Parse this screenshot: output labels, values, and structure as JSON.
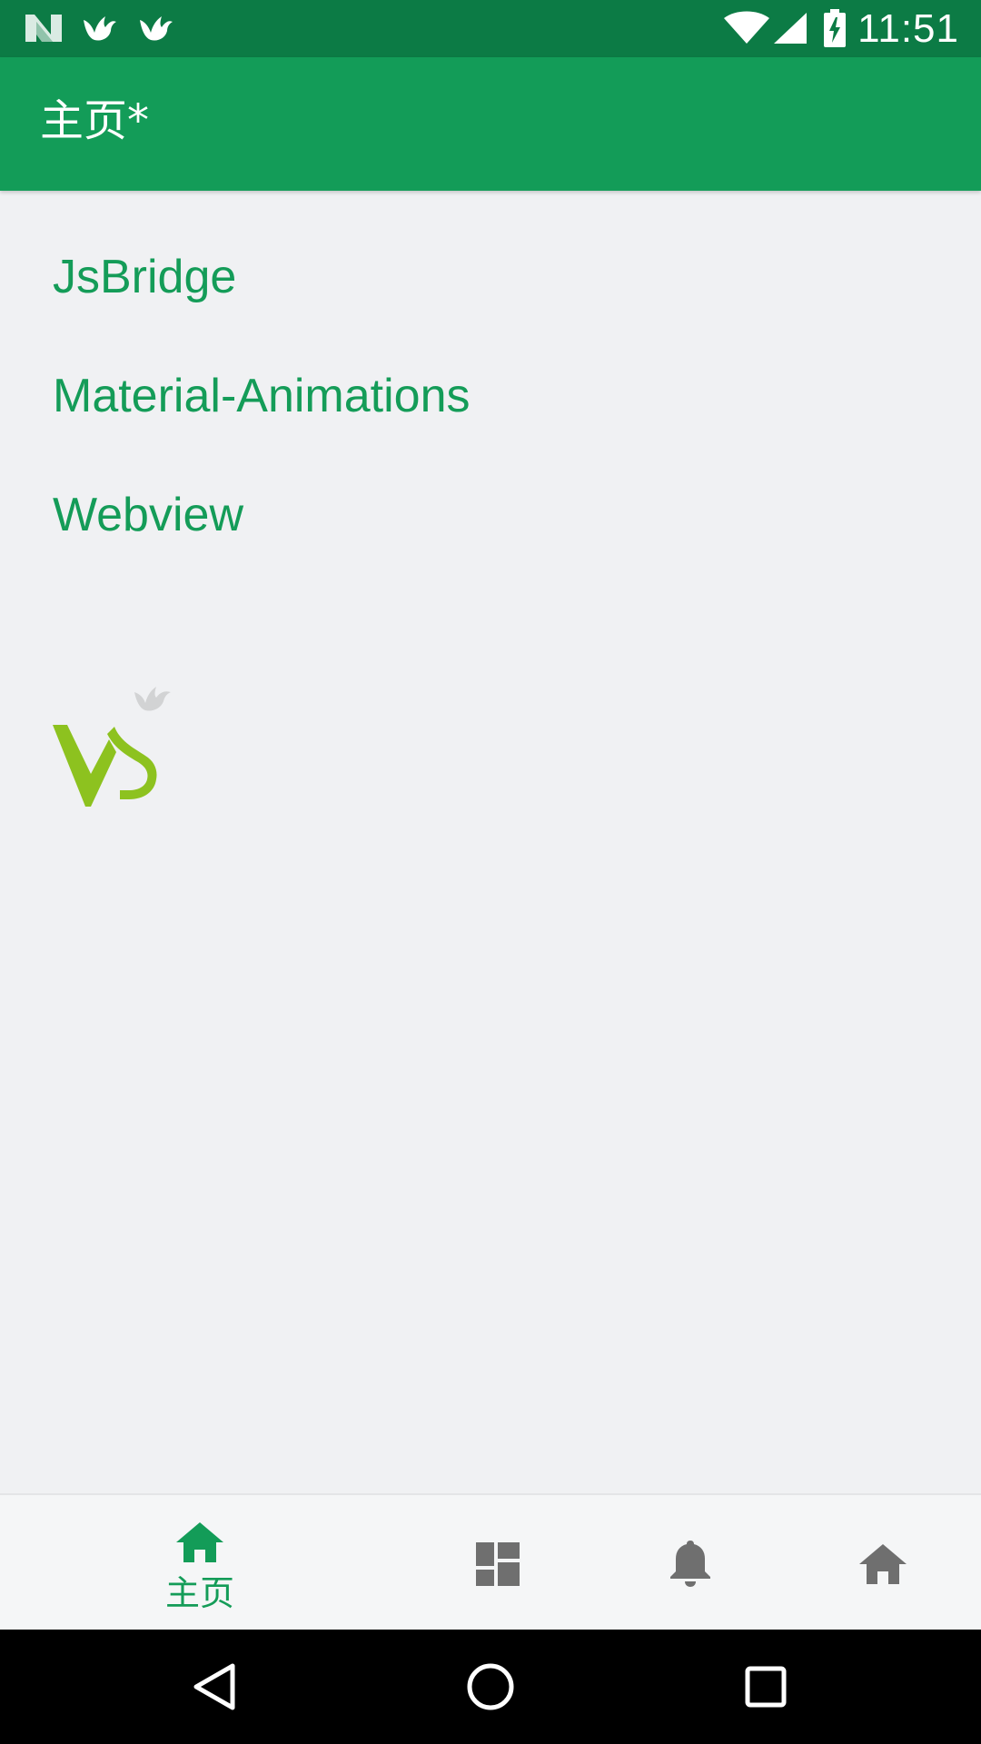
{
  "status_bar": {
    "time": "11:51",
    "icons": [
      "notification-n-icon",
      "bird-icon",
      "bird-icon",
      "wifi-icon",
      "signal-icon",
      "battery-charging-icon"
    ]
  },
  "app_bar": {
    "title": "主页*"
  },
  "list": {
    "items": [
      {
        "label": "JsBridge"
      },
      {
        "label": "Material-Animations"
      },
      {
        "label": "Webview"
      }
    ]
  },
  "logo": {
    "icon": "vs-bird-logo"
  },
  "bottom_nav": {
    "items": [
      {
        "icon": "home-icon",
        "label": "主页",
        "active": true
      },
      {
        "icon": "dashboard-icon",
        "label": "",
        "active": false
      },
      {
        "icon": "bell-icon",
        "label": "",
        "active": false
      },
      {
        "icon": "home-icon",
        "label": "",
        "active": false
      }
    ]
  },
  "system_nav": {
    "buttons": [
      "back-icon",
      "home-circle-icon",
      "recents-icon"
    ]
  },
  "colors": {
    "primary": "#139c58",
    "primary_dark": "#0c7b45",
    "accent_text": "#149c58",
    "background": "#f0f1f3",
    "inactive_icon": "#6f6f6f",
    "logo_green": "#8dc21f"
  }
}
